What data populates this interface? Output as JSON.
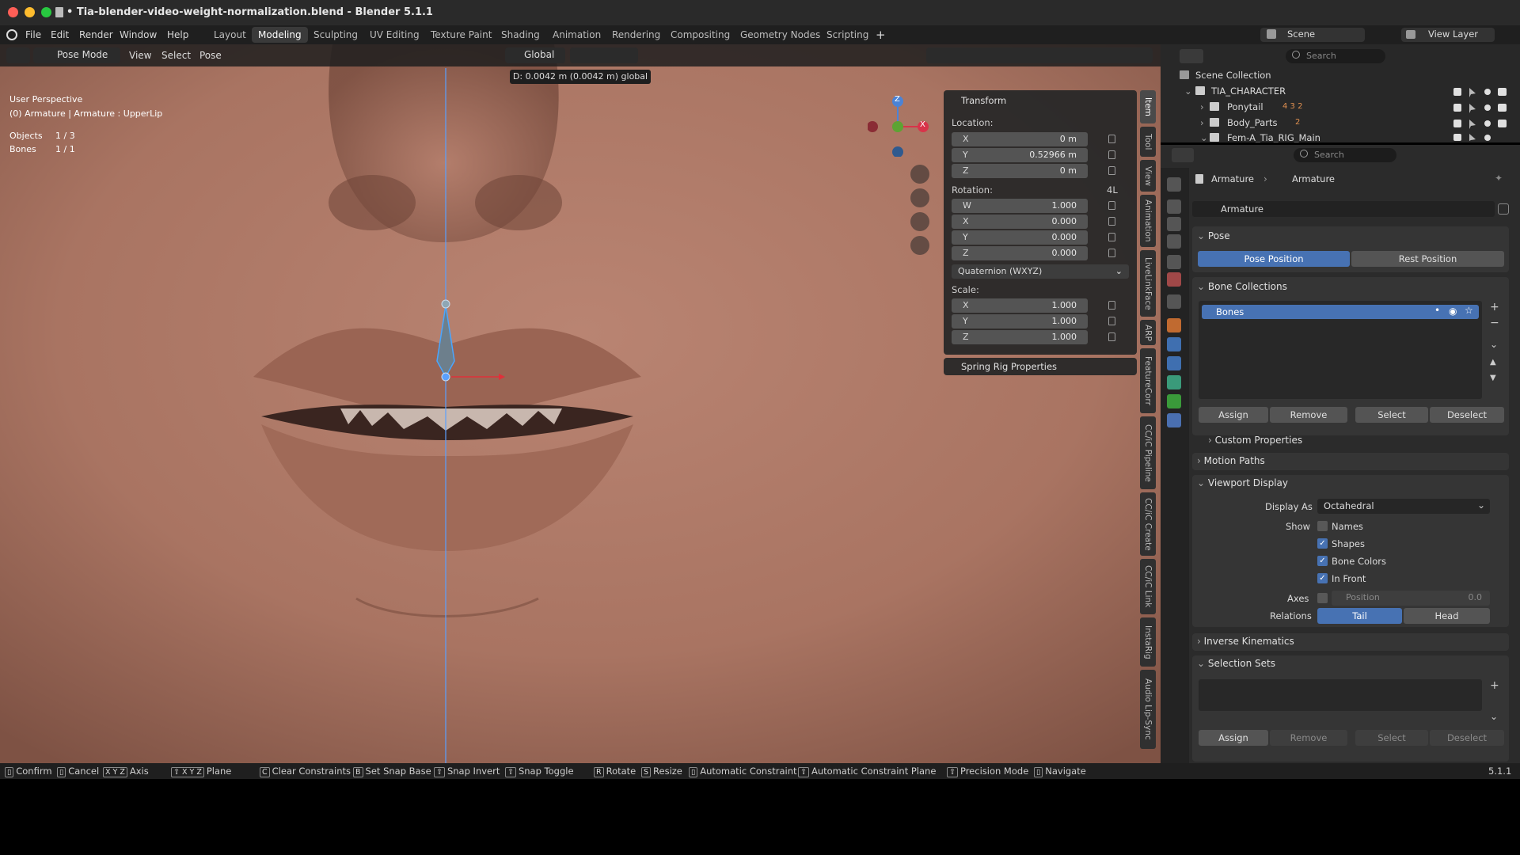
{
  "window": {
    "title": "• Tia-blender-video-weight-normalization.blend - Blender 5.1.1",
    "traffic_colors": [
      "#ff5f57",
      "#febc2e",
      "#28c840"
    ]
  },
  "menu": {
    "items": [
      "File",
      "Edit",
      "Render",
      "Window",
      "Help"
    ],
    "workspaces": [
      "Layout",
      "Modeling",
      "Sculpting",
      "UV Editing",
      "Texture Paint",
      "Shading",
      "Animation",
      "Rendering",
      "Compositing",
      "Geometry Nodes",
      "Scripting"
    ],
    "active_workspace": "Modeling",
    "scene": "Scene",
    "view_layer": "View Layer"
  },
  "viewport_header": {
    "mode": "Pose Mode",
    "menus": [
      "View",
      "Select",
      "Pose"
    ],
    "orientation": "Global",
    "transform_readout": "D:  0.0042 m (0.0042 m) global"
  },
  "overlay_text": {
    "perspective": "User Perspective",
    "context": "(0) Armature | Armature : UpperLip",
    "objects_label": "Objects",
    "objects_value": "1 / 3",
    "bones_label": "Bones",
    "bones_value": "1 / 1"
  },
  "gizmo": {
    "z": "Z",
    "x": "X"
  },
  "transform_panel": {
    "title": "Transform",
    "location_label": "Location:",
    "location": [
      {
        "axis": "X",
        "value": "0 m"
      },
      {
        "axis": "Y",
        "value": "0.52966 m"
      },
      {
        "axis": "Z",
        "value": "0 m"
      }
    ],
    "rotation_label": "Rotation:",
    "rotation_lock": "4L",
    "rotation": [
      {
        "axis": "W",
        "value": "1.000"
      },
      {
        "axis": "X",
        "value": "0.000"
      },
      {
        "axis": "Y",
        "value": "0.000"
      },
      {
        "axis": "Z",
        "value": "0.000"
      }
    ],
    "rotation_mode": "Quaternion (WXYZ)",
    "scale_label": "Scale:",
    "scale": [
      {
        "axis": "X",
        "value": "1.000"
      },
      {
        "axis": "Y",
        "value": "1.000"
      },
      {
        "axis": "Z",
        "value": "1.000"
      }
    ],
    "spring_rig": "Spring Rig Properties"
  },
  "sidebar_tabs": [
    "Item",
    "Tool",
    "View",
    "Animation",
    "LiveLinkFace",
    "ARP",
    "FeatureCorr",
    "CC/iC Pipeline",
    "CC/iC Create",
    "CC/iC Link",
    "InstaRig",
    "Audio Lip-Sync"
  ],
  "outliner": {
    "search_placeholder": "Search",
    "root": "Scene Collection",
    "rows": [
      {
        "name": "TIA_CHARACTER",
        "badges": ""
      },
      {
        "name": "Ponytail",
        "badges": "4 3 2"
      },
      {
        "name": "Body_Parts",
        "badges": "2"
      },
      {
        "name": "Fem-A_Tia_RIG_Main",
        "badges": ""
      }
    ]
  },
  "properties": {
    "search_placeholder": "Search",
    "breadcrumb": [
      "Armature",
      "Armature"
    ],
    "data_name": "Armature",
    "pose": {
      "title": "Pose",
      "pose_position": "Pose Position",
      "rest_position": "Rest Position"
    },
    "bone_collections": {
      "title": "Bone Collections",
      "item": "Bones",
      "assign": "Assign",
      "remove": "Remove",
      "select": "Select",
      "deselect": "Deselect"
    },
    "custom_properties": "Custom Properties",
    "motion_paths": "Motion Paths",
    "viewport_display": {
      "title": "Viewport Display",
      "display_as_label": "Display As",
      "display_as": "Octahedral",
      "show_label": "Show",
      "names": "Names",
      "names_checked": false,
      "shapes": "Shapes",
      "shapes_checked": true,
      "bone_colors": "Bone Colors",
      "bone_colors_checked": true,
      "in_front": "In Front",
      "in_front_checked": true,
      "axes_label": "Axes",
      "axes_position": "Position",
      "axes_value": "0.0",
      "relations_label": "Relations",
      "tail": "Tail",
      "head": "Head"
    },
    "inverse_kinematics": "Inverse Kinematics",
    "selection_sets": {
      "title": "Selection Sets",
      "assign": "Assign",
      "remove": "Remove",
      "select": "Select",
      "deselect": "Deselect"
    }
  },
  "statusbar": {
    "items": [
      {
        "key": "",
        "label": "Confirm"
      },
      {
        "key": "",
        "label": "Cancel"
      },
      {
        "key": "X Y Z",
        "label": "Axis"
      },
      {
        "key": "⇧ X Y Z",
        "label": "Plane"
      },
      {
        "key": "C",
        "label": "Clear Constraints"
      },
      {
        "key": "B",
        "label": "Set Snap Base"
      },
      {
        "key": "⇧",
        "label": "Snap Invert"
      },
      {
        "key": "⇧",
        "label": "Snap Toggle"
      },
      {
        "key": "R",
        "label": "Rotate"
      },
      {
        "key": "S",
        "label": "Resize"
      },
      {
        "key": "",
        "label": "Automatic Constraint"
      },
      {
        "key": "⇧",
        "label": "Automatic Constraint Plane"
      },
      {
        "key": "⇧",
        "label": "Precision Mode"
      },
      {
        "key": "",
        "label": "Navigate"
      }
    ],
    "version": "5.1.1"
  }
}
